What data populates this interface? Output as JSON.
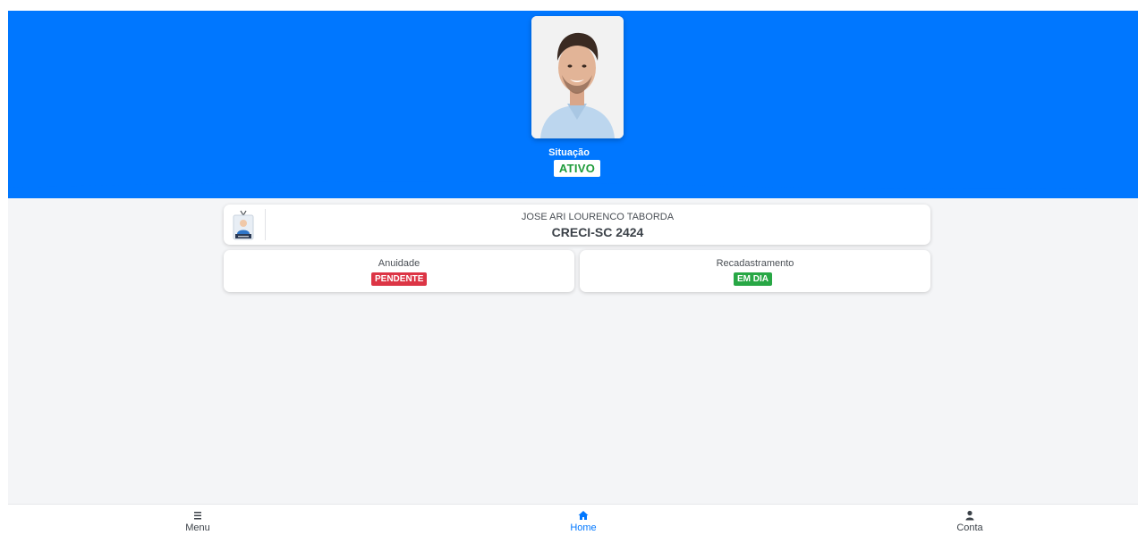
{
  "profile": {
    "situacao_label": "Situação",
    "situacao_value": "ATIVO",
    "name": "JOSE ARI LOURENCO TABORDA",
    "creci": "CRECI-SC 2424"
  },
  "status_cards": {
    "anuidade": {
      "label": "Anuidade",
      "status": "PENDENTE"
    },
    "recadastramento": {
      "label": "Recadastramento",
      "status": "EM DIA"
    }
  },
  "nav": {
    "items": [
      {
        "label": "Menu",
        "icon": "menu-icon"
      },
      {
        "label": "Home",
        "icon": "home-icon",
        "active": true
      },
      {
        "label": "Conta",
        "icon": "user-icon"
      }
    ]
  },
  "colors": {
    "primary": "#0077ff",
    "success": "#28a745",
    "danger": "#dc3545",
    "background": "#f4f5f7"
  }
}
